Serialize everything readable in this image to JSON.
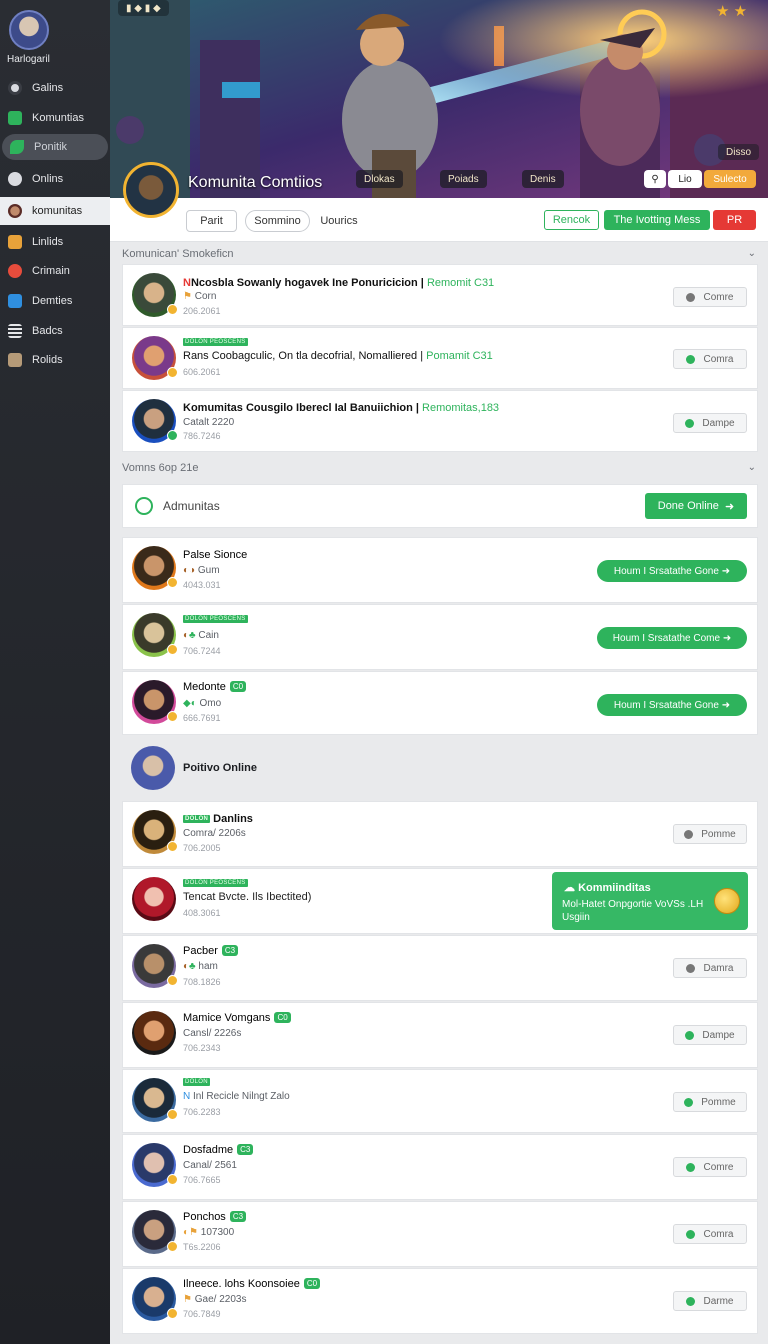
{
  "colors": {
    "accent": "#2eb35c",
    "sidebar": "#26292e",
    "danger": "#e53935",
    "orange": "#f2a93b"
  },
  "sidebar": {
    "user_name": "Harlogaril",
    "items": [
      {
        "label": "Galins",
        "icon": "search-icon",
        "color": "#d9dbe0"
      },
      {
        "label": "Komuntias",
        "icon": "green-square-icon",
        "color": "#2eb35c"
      },
      {
        "label": "Ponitik",
        "icon": "leaf-icon",
        "color": "#2eb35c"
      },
      {
        "label": "Onlins",
        "icon": "globe-icon",
        "color": "#d9dbe0"
      },
      {
        "label": "komunitas",
        "icon": "user-icon",
        "color": "#c08a6b"
      },
      {
        "label": "Linlids",
        "icon": "badge-icon",
        "color": "#e8a23a"
      },
      {
        "label": "Crimain",
        "icon": "circle-icon",
        "color": "#e74c3c"
      },
      {
        "label": "Demties",
        "icon": "monitor-icon",
        "color": "#2f8fe0"
      },
      {
        "label": "Badcs",
        "icon": "list-icon",
        "color": "#e6e7ea"
      },
      {
        "label": "Rolids",
        "icon": "grid-icon",
        "color": "#b59a78"
      }
    ]
  },
  "banner": {
    "title": "Komunita Comtiios",
    "chips": [
      "Dlokas",
      "Poiads",
      "Denis"
    ],
    "corner_label": "Disso",
    "search_btn": "Lio",
    "join_btn": "Sulecto"
  },
  "tabs": {
    "items": [
      "Parit",
      "Sommino",
      "Uourics"
    ],
    "btn_recent": "Rencok",
    "btn_main": "The Ivotting Mess",
    "btn_report": "PR"
  },
  "section1": {
    "title": "Komunican' Smokeficn",
    "rows": [
      {
        "title": "Ncosbla Sowanly hogavek Ine Ponuricicion |",
        "title_green": "Remomit C31",
        "sub": "Corn",
        "meta": "206.2061",
        "btn": "Comre"
      },
      {
        "tag": "DOLON PEOSCENS",
        "title": "Rans Coobagculic, On tla decofrial, Nomalliered |",
        "title_green": "Pomamit C31",
        "meta": "606.2061",
        "btn": "Comra"
      },
      {
        "title": "Komumitas Cousgilo Iberecl Ial Banuiichion |",
        "title_green": "Remomitas,183",
        "sub": "Catalt 2220",
        "meta": "786.7246",
        "btn": "Dampe"
      }
    ]
  },
  "section2": {
    "title": "Vomns 6op 21e",
    "header_label": "Admunitas",
    "header_btn": "Done Online",
    "rows": [
      {
        "title": "Palse Sionce",
        "sub": "Gum",
        "meta": "4043.031",
        "btn": "Houm I Srsatathe Gone"
      },
      {
        "tag": "DOLON PEOSCENS",
        "sub": "Cain",
        "meta": "706.7244",
        "btn": "Houm I Srsatathe Come"
      },
      {
        "title": "Medonte",
        "badge": "C0",
        "sub": "Omo",
        "meta": "666.7691",
        "btn": "Houm I Srsatathe Gone"
      }
    ]
  },
  "online": {
    "title": "Poitivo Online",
    "rows": [
      {
        "tag": "DOLON",
        "title": "Danlins",
        "sub": "Comra/ 2206s",
        "meta": "706.2005",
        "btn": "Pomme"
      },
      {
        "tag": "DOLON PEOSCENS",
        "title": "Tencat Bvcte. Ils Ibectited)",
        "meta": "408.3061"
      },
      {
        "title": "Pacber",
        "badge": "C3",
        "sub": "ham",
        "meta": "708.1826",
        "btn": "Damra"
      },
      {
        "title": "Mamice Vomgans",
        "badge": "C0",
        "sub": "Cansl/ 2226s",
        "meta": "706.2343",
        "btn": "Dampe"
      },
      {
        "tag": "DOLON",
        "sub": "Inl Recicle Nilngt Zalo",
        "meta": "706.2283",
        "btn": "Pomme"
      },
      {
        "title": "Dosfadme",
        "badge": "C3",
        "sub": "Canal/ 2561",
        "meta": "706.7665",
        "btn": "Comre"
      },
      {
        "title": "Ponchos",
        "badge": "C3",
        "sub": "107300",
        "meta": "T6s.2206",
        "btn": "Comra"
      },
      {
        "title": "Ilneece. lohs Koonsoiee",
        "badge": "C0",
        "sub": "Gae/ 2203s",
        "meta": "706.7849",
        "btn": "Darme"
      }
    ]
  },
  "popover": {
    "title": "Kommiinditas",
    "text": "Mol-Hatet Onpgortie VoVSs .LH Usgiin"
  }
}
